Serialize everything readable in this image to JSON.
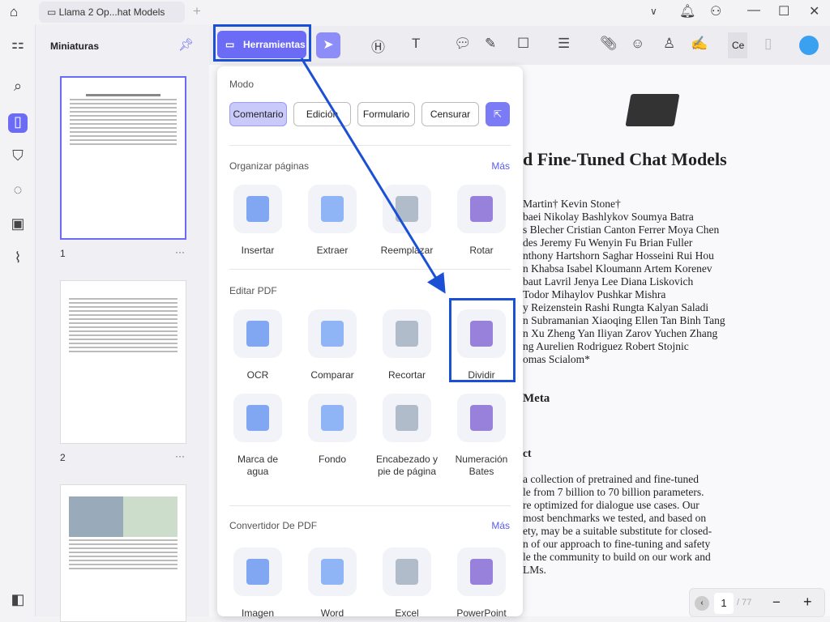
{
  "titlebar": {
    "tab_title": "Llama 2 Op...hat Models",
    "new_tab": "+"
  },
  "thumbnails": {
    "title": "Miniaturas",
    "pages": [
      "1",
      "2"
    ],
    "more": "···"
  },
  "toolbar": {
    "herramientas": "Herramientas",
    "cut_label": "Ce"
  },
  "panel": {
    "mode_title": "Modo",
    "modes": [
      "Comentario",
      "Edición",
      "Formulario",
      "Censurar"
    ],
    "organize_title": "Organizar páginas",
    "organize_more": "Más",
    "organize": [
      "Insertar",
      "Extraer",
      "Reemplazar",
      "Rotar"
    ],
    "edit_title": "Editar PDF",
    "edit": [
      "OCR",
      "Comparar",
      "Recortar",
      "Dividir",
      "Marca de agua",
      "Fondo",
      "Encabezado y pie de página",
      "Numeración Bates"
    ],
    "convert_title": "Convertidor De PDF",
    "convert_more": "Más",
    "convert": [
      "Imagen",
      "Word",
      "Excel",
      "PowerPoint"
    ]
  },
  "document": {
    "title": "d Fine-Tuned Chat Models",
    "authors": [
      "Martin†   Kevin Stone†",
      "baei  Nikolay Bashlykov  Soumya Batra",
      "s Blecher  Cristian Canton Ferrer  Moya Chen",
      "des  Jeremy Fu  Wenyin Fu  Brian Fuller",
      "nthony Hartshorn  Saghar Hosseini  Rui Hou",
      "n Khabsa  Isabel Kloumann  Artem Korenev",
      "baut Lavril  Jenya Lee  Diana Liskovich",
      "  Todor Mihaylov  Pushkar Mishra",
      "y Reizenstein  Rashi Rungta  Kalyan Saladi",
      "n Subramanian  Xiaoqing Ellen Tan  Binh Tang",
      "n Xu  Zheng Yan  Iliyan Zarov  Yuchen Zhang",
      "ng  Aurelien Rodriguez  Robert Stojnic",
      "omas Scialom*"
    ],
    "org": "Meta",
    "abstract_heading": "ct",
    "abstract": [
      "a collection of pretrained and fine-tuned",
      "le from 7 billion to 70 billion parameters.",
      "re optimized for dialogue use cases.  Our",
      "most benchmarks we tested, and based on",
      "ety, may be a suitable substitute for closed-",
      "n of our approach to fine-tuning and safety",
      "le the community to build on our work and",
      "LMs."
    ]
  },
  "pager": {
    "current": "1",
    "total": "/ 77",
    "minus": "−",
    "plus": "+"
  },
  "colors": {
    "accent": "#6b6bf5",
    "highlight": "#1a4fd6"
  }
}
